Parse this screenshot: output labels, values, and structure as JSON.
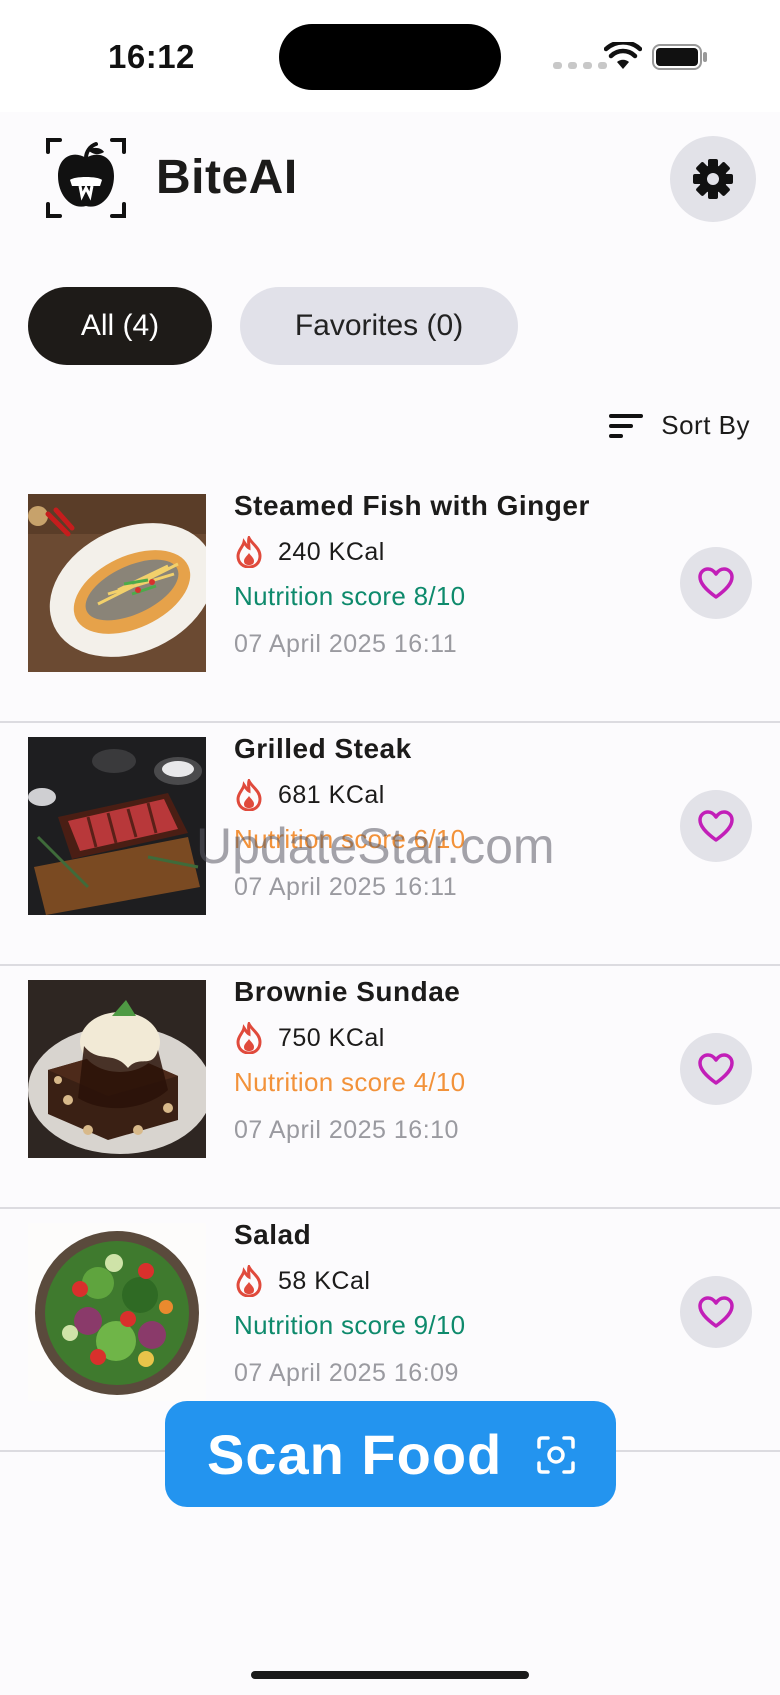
{
  "status_bar": {
    "time": "16:12"
  },
  "header": {
    "title": "BiteAI",
    "logo_icon": "apple-scan-logo-icon",
    "settings_icon": "gear-icon"
  },
  "filters": {
    "all_label": "All (4)",
    "favorites_label": "Favorites (0)"
  },
  "sort": {
    "label": "Sort By",
    "icon": "sort-lines-icon"
  },
  "items": [
    {
      "title": "Steamed Fish with Ginger",
      "kcal": "240 KCal",
      "score": "Nutrition score 8/10",
      "score_level": "good",
      "date": "07 April 2025 16:11",
      "photo": "steamed-fish"
    },
    {
      "title": "Grilled Steak",
      "kcal": "681 KCal",
      "score": "Nutrition score 6/10",
      "score_level": "mid",
      "date": "07 April 2025 16:11",
      "photo": "grilled-steak"
    },
    {
      "title": "Brownie Sundae",
      "kcal": "750 KCal",
      "score": "Nutrition score 4/10",
      "score_level": "mid",
      "date": "07 April 2025 16:10",
      "photo": "brownie-sundae"
    },
    {
      "title": "Salad",
      "kcal": "58 KCal",
      "score": "Nutrition score 9/10",
      "score_level": "good",
      "date": "07 April 2025 16:09",
      "photo": "salad"
    }
  ],
  "scan_button": {
    "label": "Scan Food",
    "icon": "scan-camera-icon"
  },
  "watermark": "UpdateStar.com",
  "colors": {
    "accent": "#2394ef",
    "score_good": "#0e8a6c",
    "score_mid": "#f2923a",
    "heart": "#c21fb8",
    "chip_active": "#1e1b18",
    "flame": "#e04a3c"
  }
}
